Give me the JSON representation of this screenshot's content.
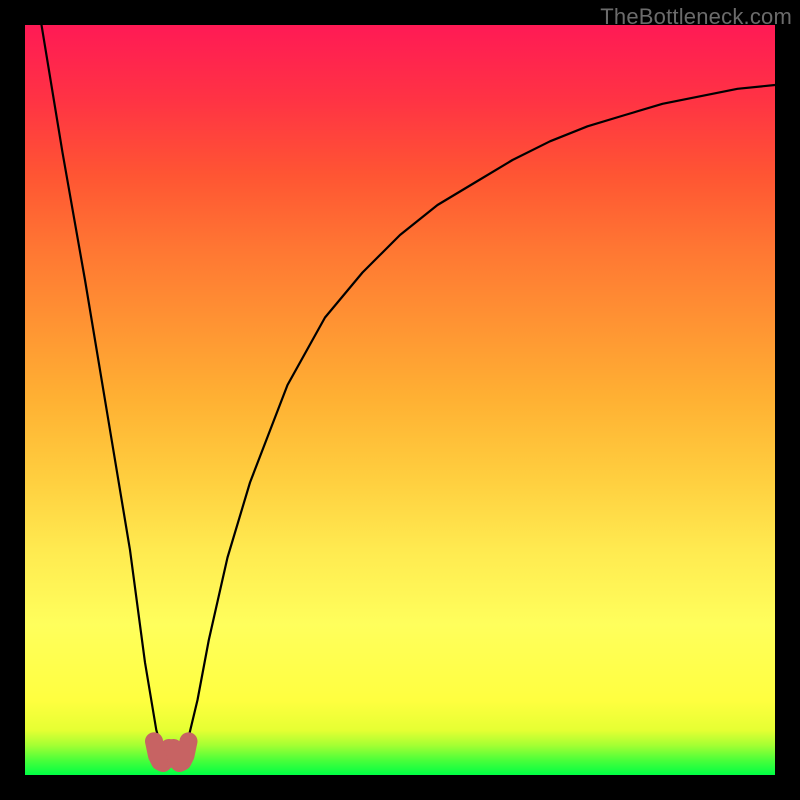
{
  "watermark": {
    "text": "TheBottleneck.com"
  },
  "chart_data": {
    "type": "line",
    "title": "",
    "xlabel": "",
    "ylabel": "",
    "xlim": [
      0,
      100
    ],
    "ylim": [
      0,
      100
    ],
    "grid": false,
    "legend": false,
    "notes": "Single V-shaped bottleneck curve; color gradient green(low)→red(high); values estimated from plot area (750×750 px mapped to 0–100).",
    "series": [
      {
        "name": "bottleneck-curve",
        "color": "#000000",
        "x": [
          2.2,
          5,
          8,
          11,
          14,
          16,
          17.5,
          18.5,
          19,
          20,
          21,
          21.8,
          23,
          24.5,
          27,
          30,
          35,
          40,
          45,
          50,
          55,
          60,
          65,
          70,
          75,
          80,
          85,
          90,
          95,
          100
        ],
        "y": [
          100,
          83,
          66,
          48,
          30,
          15,
          6,
          2.5,
          3,
          2.5,
          3,
          5,
          10,
          18,
          29,
          39,
          52,
          61,
          67,
          72,
          76,
          79,
          82,
          84.5,
          86.5,
          88,
          89.5,
          90.5,
          91.5,
          92
        ]
      },
      {
        "name": "nub-left",
        "color": "#c76363",
        "x": [
          17.2,
          17.6,
          18.0,
          18.4,
          18.8,
          19.2
        ],
        "y": [
          4.5,
          2.6,
          1.8,
          1.6,
          2.0,
          3.6
        ]
      },
      {
        "name": "nub-right",
        "color": "#c76363",
        "x": [
          19.8,
          20.2,
          20.6,
          21.0,
          21.4,
          21.8
        ],
        "y": [
          3.6,
          2.0,
          1.6,
          1.8,
          2.6,
          4.5
        ]
      }
    ],
    "gradient_stops": [
      {
        "pos": 0,
        "color": "#00ff44"
      },
      {
        "pos": 10,
        "color": "#ffff40"
      },
      {
        "pos": 50,
        "color": "#ffb133"
      },
      {
        "pos": 100,
        "color": "#ff1a55"
      }
    ]
  }
}
